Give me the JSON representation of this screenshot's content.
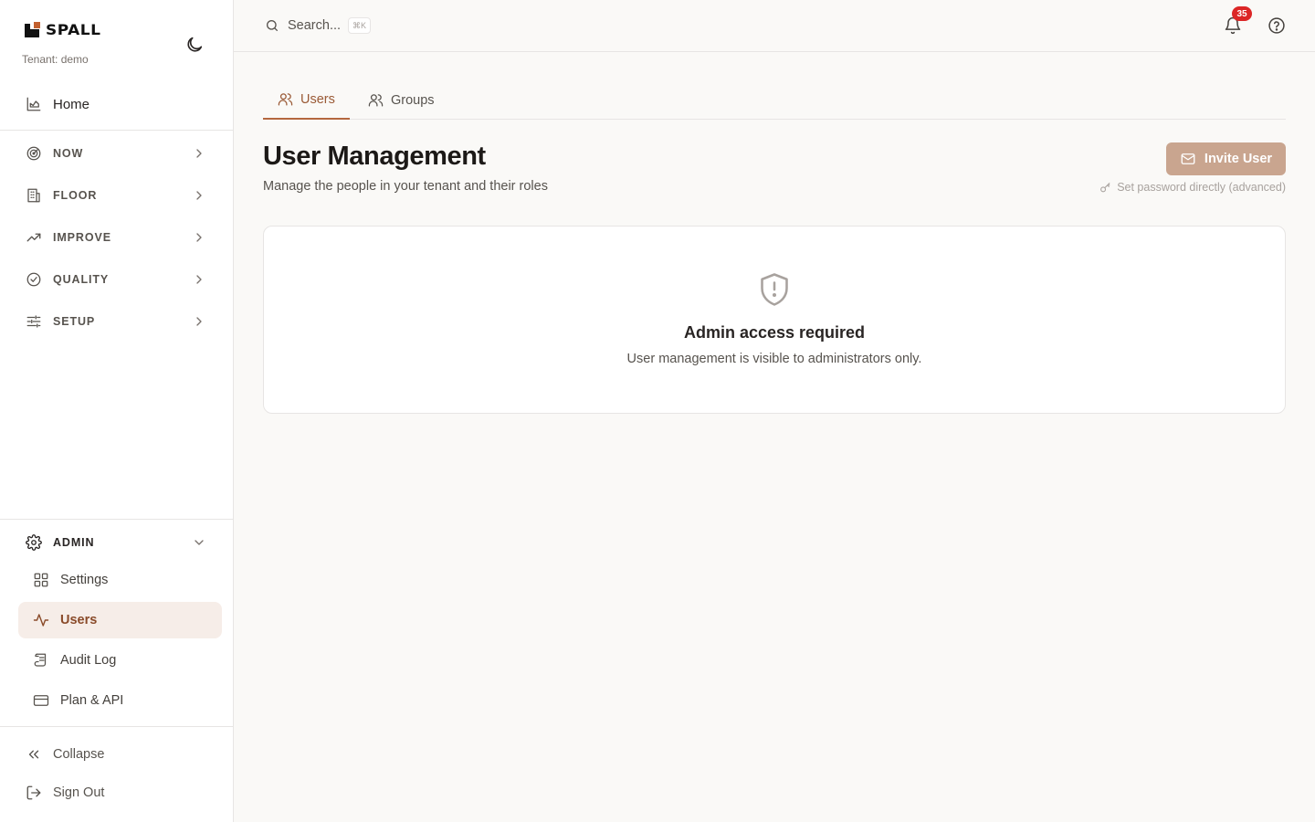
{
  "brand": {
    "logo_text": "SPALL",
    "tenant": "Tenant: demo"
  },
  "sidebar": {
    "home": "Home",
    "sections": [
      {
        "label": "NOW",
        "icon": "radar-icon"
      },
      {
        "label": "FLOOR",
        "icon": "building-icon"
      },
      {
        "label": "IMPROVE",
        "icon": "trending-up-icon"
      },
      {
        "label": "QUALITY",
        "icon": "check-circle-icon"
      },
      {
        "label": "SETUP",
        "icon": "sliders-icon"
      }
    ],
    "admin": {
      "label": "ADMIN",
      "items": [
        {
          "label": "Settings",
          "icon": "grid-icon",
          "active": false
        },
        {
          "label": "Users",
          "icon": "activity-icon",
          "active": true
        },
        {
          "label": "Audit Log",
          "icon": "scroll-icon",
          "active": false
        },
        {
          "label": "Plan & API",
          "icon": "credit-card-icon",
          "active": false
        }
      ]
    },
    "collapse": "Collapse",
    "sign_out": "Sign Out"
  },
  "topbar": {
    "search_placeholder": "Search...",
    "shortcut": "⌘K",
    "notification_count": "35"
  },
  "tabs": [
    {
      "label": "Users",
      "active": true
    },
    {
      "label": "Groups",
      "active": false
    }
  ],
  "header": {
    "title": "User Management",
    "subtitle": "Manage the people in your tenant and their roles",
    "invite_label": "Invite User",
    "set_password_label": "Set password directly (advanced)"
  },
  "notice": {
    "title": "Admin access required",
    "text": "User management is visible to administrators only."
  },
  "colors": {
    "accent": "#b4673f",
    "invite_button": "#c9a58f",
    "badge": "#dc2626",
    "active_bg": "#f6ede8"
  }
}
